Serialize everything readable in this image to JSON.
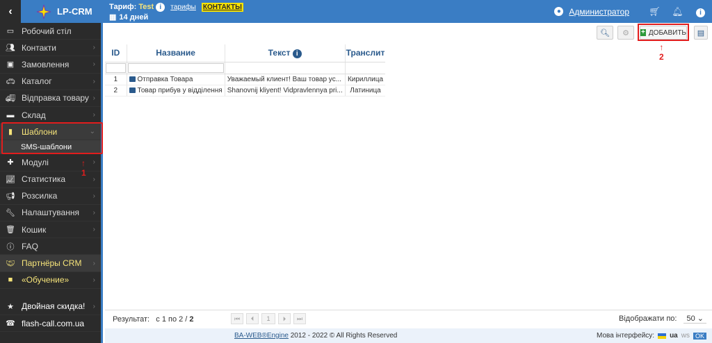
{
  "topbar": {
    "logo": "LP-CRM",
    "tariff_label": "Тариф:",
    "tariff_value": "Test",
    "tariffs_link": "тарифы",
    "contacts_link": "КОНТАКТЫ",
    "days": "14 дней",
    "user": "Администратор"
  },
  "sidebar": {
    "items": [
      {
        "label": "Робочий стіл",
        "icon": "monitor-icon"
      },
      {
        "label": "Контакти",
        "icon": "users-icon"
      },
      {
        "label": "Замовлення",
        "icon": "money-icon"
      },
      {
        "label": "Каталог",
        "icon": "car-icon"
      },
      {
        "label": "Відправка товару",
        "icon": "truck-icon"
      },
      {
        "label": "Склад",
        "icon": "archive-icon"
      },
      {
        "label": "Шаблони",
        "icon": "file-icon"
      },
      {
        "label": "Модулі",
        "icon": "puzzle-icon"
      },
      {
        "label": "Статистика",
        "icon": "chart-icon"
      },
      {
        "label": "Розсилка",
        "icon": "bullhorn-icon"
      },
      {
        "label": "Налаштування",
        "icon": "wrench-icon"
      },
      {
        "label": "Кошик",
        "icon": "trash-icon"
      },
      {
        "label": "FAQ",
        "icon": "info-icon"
      },
      {
        "label": "Партнёры CRM",
        "icon": "handshake-icon"
      },
      {
        "label": "«Обучение»",
        "icon": "video-icon"
      },
      {
        "label": "Двойная скидка!",
        "icon": "star-icon"
      },
      {
        "label": "flash-call.com.ua",
        "icon": "phone-icon"
      }
    ],
    "sub_item": "SMS-шаблони",
    "annotation_1": "1"
  },
  "toolbar": {
    "add_label": "ДОБАВИТЬ",
    "annotation_2": "2"
  },
  "table": {
    "headers": [
      "ID",
      "Название",
      "Текст",
      "Транслит"
    ],
    "rows": [
      {
        "id": "1",
        "name": "Отправка Товара",
        "text": "Уважаемый клиент! Ваш товар ус...",
        "translit": "Кириллица"
      },
      {
        "id": "2",
        "name": "Товар прибув у відділення",
        "text": "Shanovnij kliyent! Vidpravlennya pri...",
        "translit": "Латиница"
      }
    ]
  },
  "footer": {
    "result_label": "Результат:",
    "result_value": "с 1 по 2 / ",
    "result_total": "2",
    "page": "1",
    "perpage_label": "Відображати по:",
    "perpage_value": "50",
    "copyright_link": "BA-WEB®Engine",
    "copyright_rest": " 2012 - 2022 © All Rights Reserved",
    "lang_label": "Мова інтерфейсу:",
    "lang_value": "ua",
    "ws": "ws",
    "ok": "OK"
  }
}
